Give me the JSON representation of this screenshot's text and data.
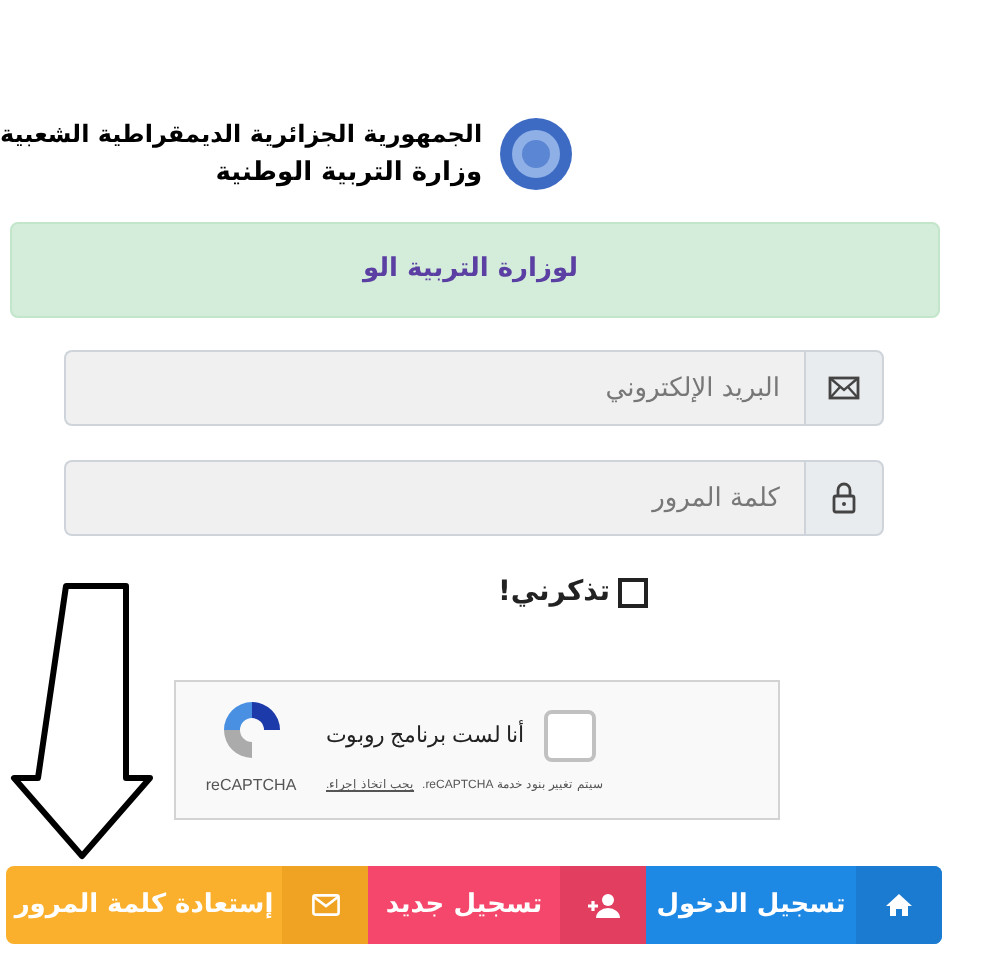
{
  "header": {
    "title": "الجمهورية الجزائرية الديمقراطية الشعبية",
    "subtitle": "وزارة التربية الوطنية"
  },
  "alert": {
    "text": "لوزارة التربية الو"
  },
  "fields": [
    {
      "kind": "email",
      "placeholder": "البريد الإلكتروني"
    },
    {
      "kind": "password",
      "placeholder": "كلمة المرور"
    }
  ],
  "remember": {
    "label": "تذكرني!",
    "checked": false
  },
  "captcha": {
    "label": "أنا لست برنامج روبوت",
    "checked": false,
    "brand": "reCAPTCHA",
    "notice": "سيتم تغيير بنود خدمة reCAPTCHA.",
    "notice_link": "يجب اتخاذ إجراء."
  },
  "buttons": [
    {
      "kind": "login",
      "label": "تسجيل الدخول"
    },
    {
      "kind": "register",
      "label": "تسجيل جديد"
    },
    {
      "kind": "recover",
      "label": "إستعادة كلمة المرور"
    }
  ]
}
